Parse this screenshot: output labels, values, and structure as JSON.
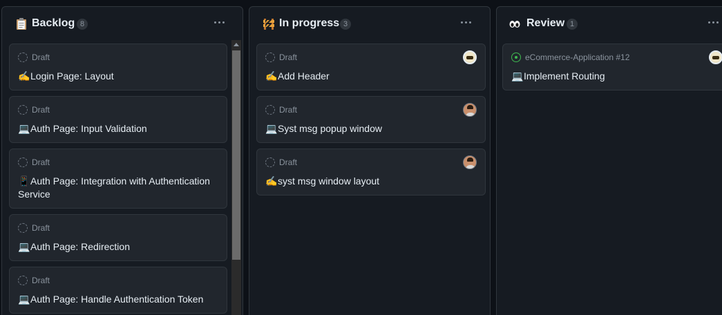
{
  "columns": [
    {
      "title": "Backlog",
      "count": "8",
      "icon": "clipboard-icon",
      "cards": [
        {
          "meta": "Draft",
          "emoji": "✍️",
          "title": "Login Page: Layout"
        },
        {
          "meta": "Draft",
          "emoji": "💻",
          "title": "Auth Page: Input Validation"
        },
        {
          "meta": "Draft",
          "emoji": "📱",
          "title": "Auth Page: Integration with Authentication Service"
        },
        {
          "meta": "Draft",
          "emoji": "💻",
          "title": "Auth Page: Redirection"
        },
        {
          "meta": "Draft",
          "emoji": "💻",
          "title": "Auth Page: Handle Authentication Token"
        }
      ]
    },
    {
      "title": "In progress",
      "count": "3",
      "icon": "construction-icon",
      "cards": [
        {
          "meta": "Draft",
          "emoji": "✍️",
          "title": "Add Header"
        },
        {
          "meta": "Draft",
          "emoji": "💻",
          "title": "Syst msg popup window"
        },
        {
          "meta": "Draft",
          "emoji": "✍️",
          "title": "syst msg window layout"
        }
      ]
    },
    {
      "title": "Review",
      "count": "1",
      "icon": "eyes-icon",
      "cards": [
        {
          "meta": "eCommerce-Application #12",
          "emoji": "💻",
          "title": "Implement Routing"
        }
      ]
    }
  ],
  "colors": {
    "background": "#0d1117",
    "column": "#161b22",
    "card": "#21262d",
    "border": "#30363d",
    "muted_text": "#8b949e",
    "open_issue": "#3fb950"
  }
}
